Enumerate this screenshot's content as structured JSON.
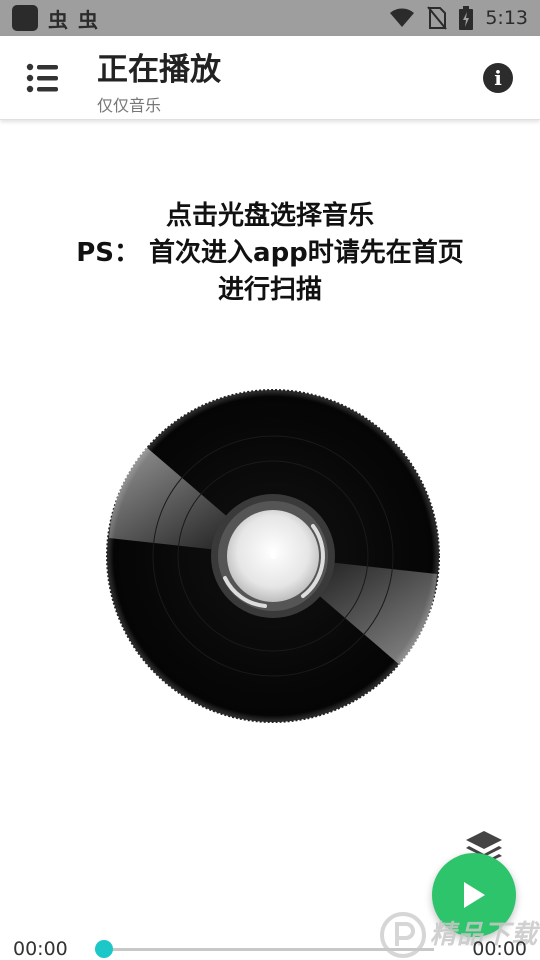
{
  "status_bar": {
    "glyph_a": "虫",
    "glyph_b": "虫",
    "time": "5:13",
    "icons": [
      "app-icon",
      "wifi-icon",
      "no-sim-icon",
      "battery-icon"
    ]
  },
  "toolbar": {
    "title": "正在播放",
    "subtitle": "仅仅音乐",
    "menu_icon": "list-menu-icon",
    "info_icon": "info-icon",
    "info_glyph": "i"
  },
  "main": {
    "instructions": [
      "点击光盘选择音乐",
      "PS： 首次进入app时请先在首页",
      "进行扫描"
    ],
    "disc_icon": "vinyl-disc-icon"
  },
  "controls": {
    "layers_icon": "layers-icon",
    "play_icon": "play-icon",
    "accent_color": "#2ec46b",
    "seek_color": "#1bc7c7"
  },
  "progress": {
    "elapsed": "00:00",
    "total": "00:00",
    "position_fraction": 0
  },
  "watermark": {
    "text": "精品下载"
  }
}
